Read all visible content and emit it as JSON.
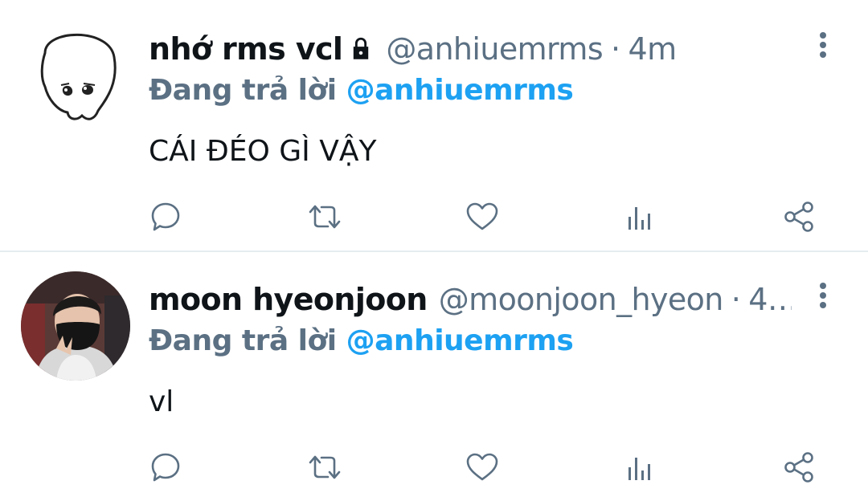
{
  "tweets": [
    {
      "display_name": "nhớ rms vcl",
      "protected": true,
      "handle": "@anhiuemrms",
      "separator": "·",
      "time": "4m",
      "replying_label": "Đang trả lời",
      "replying_to": "@anhiuemrms",
      "text": "CÁI ĐÉO GÌ VẬY"
    },
    {
      "display_name": "moon hyeonjoon",
      "protected": false,
      "handle": "@moonjoon_hyeon",
      "separator": "·",
      "time": "4…",
      "replying_label": "Đang trả lời",
      "replying_to": "@anhiuemrms",
      "text": "vl"
    }
  ],
  "icons": {
    "reply": "reply-icon",
    "retweet": "retweet-icon",
    "like": "heart-icon",
    "stats": "analytics-icon",
    "share": "share-icon",
    "more": "more-vertical-icon",
    "lock": "lock-icon"
  },
  "colors": {
    "text": "#0f1419",
    "secondary": "#5b7083",
    "link": "#1da1f2",
    "divider": "#e6ecf0"
  }
}
